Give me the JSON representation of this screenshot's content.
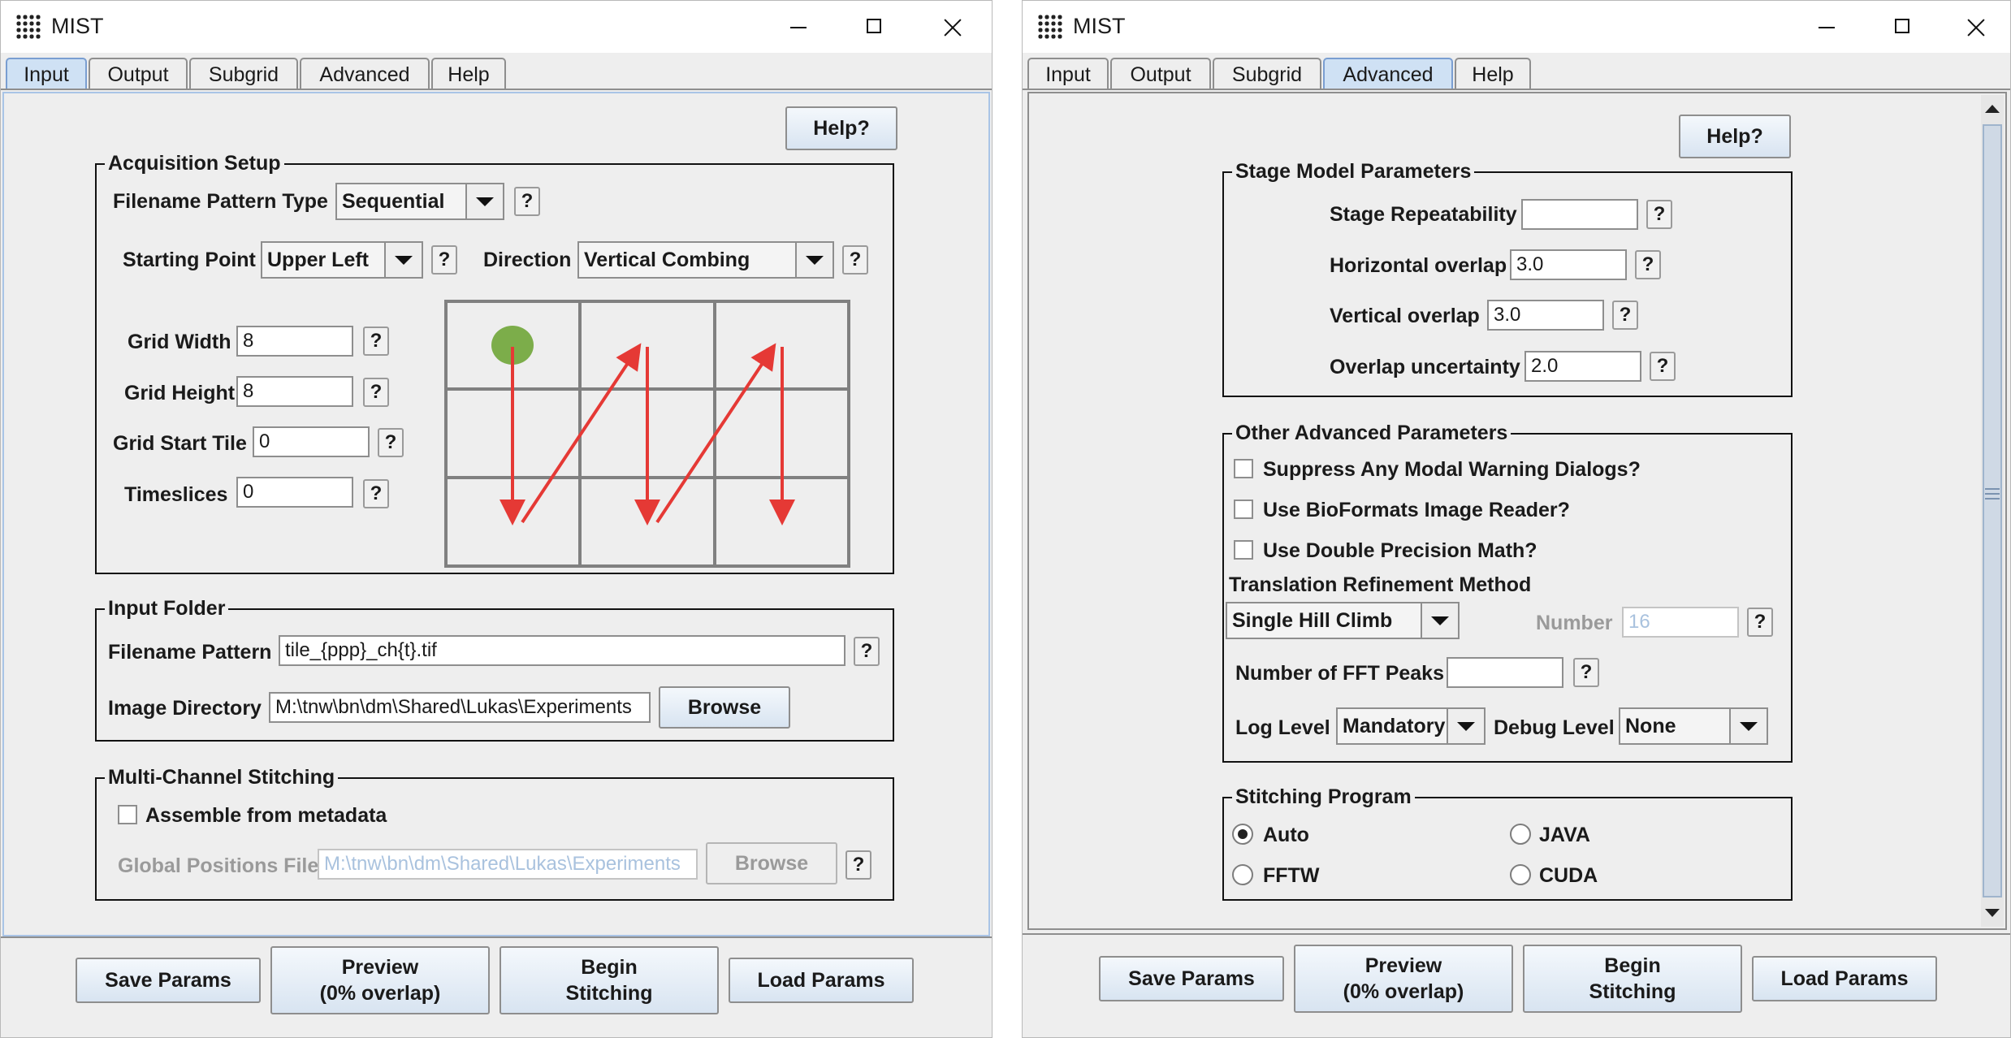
{
  "left": {
    "title": "MIST",
    "tabs": [
      "Input",
      "Output",
      "Subgrid",
      "Advanced",
      "Help"
    ],
    "help_button": "Help?",
    "acq": {
      "title": "Acquisition Setup",
      "filename_pattern_type_label": "Filename Pattern Type",
      "filename_pattern_type_value": "Sequential",
      "starting_point_label": "Starting Point",
      "starting_point_value": "Upper Left",
      "direction_label": "Direction",
      "direction_value": "Vertical Combing",
      "grid_width_label": "Grid Width",
      "grid_width_value": "8",
      "grid_height_label": "Grid Height",
      "grid_height_value": "8",
      "grid_start_tile_label": "Grid Start Tile",
      "grid_start_tile_value": "0",
      "timeslices_label": "Timeslices",
      "timeslices_value": "0"
    },
    "input_folder": {
      "title": "Input Folder",
      "filename_pattern_label": "Filename Pattern",
      "filename_pattern_value": "tile_{ppp}_ch{t}.tif",
      "image_directory_label": "Image Directory",
      "image_directory_value": "M:\\tnw\\bn\\dm\\Shared\\Lukas\\Experiments",
      "browse": "Browse"
    },
    "multi": {
      "title": "Multi-Channel Stitching",
      "assemble_label": "Assemble from metadata",
      "global_positions_label": "Global Positions File",
      "global_positions_value": "M:\\tnw\\bn\\dm\\Shared\\Lukas\\Experiments",
      "browse": "Browse"
    },
    "bottom": {
      "save": "Save Params",
      "preview_1": "Preview",
      "preview_2": "(0% overlap)",
      "begin_1": "Begin",
      "begin_2": "Stitching",
      "load": "Load Params"
    }
  },
  "right": {
    "title": "MIST",
    "tabs": [
      "Input",
      "Output",
      "Subgrid",
      "Advanced",
      "Help"
    ],
    "help_button": "Help?",
    "stage": {
      "title": "Stage Model Parameters",
      "repeatability_label": "Stage Repeatability",
      "repeatability_value": "",
      "horizontal_label": "Horizontal overlap",
      "horizontal_value": "3.0",
      "vertical_label": "Vertical overlap",
      "vertical_value": "3.0",
      "uncertainty_label": "Overlap uncertainty",
      "uncertainty_value": "2.0"
    },
    "other": {
      "title": "Other Advanced Parameters",
      "suppress_label": "Suppress Any Modal Warning Dialogs?",
      "bioformats_label": "Use BioFormats Image Reader?",
      "double_label": "Use Double Precision Math?",
      "refinement_label": "Translation Refinement Method",
      "refinement_value": "Single Hill Climb",
      "number_label": "Number",
      "number_value": "16",
      "fft_label": "Number of FFT Peaks",
      "fft_value": "",
      "log_label": "Log Level",
      "log_value": "Mandatory",
      "debug_label": "Debug Level",
      "debug_value": "None"
    },
    "program": {
      "title": "Stitching Program",
      "auto": "Auto",
      "java": "JAVA",
      "fftw": "FFTW",
      "cuda": "CUDA",
      "selected": "Auto"
    },
    "bottom": {
      "save": "Save Params",
      "preview_1": "Preview",
      "preview_2": "(0% overlap)",
      "begin_1": "Begin",
      "begin_2": "Stitching",
      "load": "Load Params"
    }
  },
  "colors": {
    "arrow": "#e53935",
    "start_dot": "#7cad4a",
    "tab_active": "#cfe1f4"
  },
  "question_mark": "?"
}
